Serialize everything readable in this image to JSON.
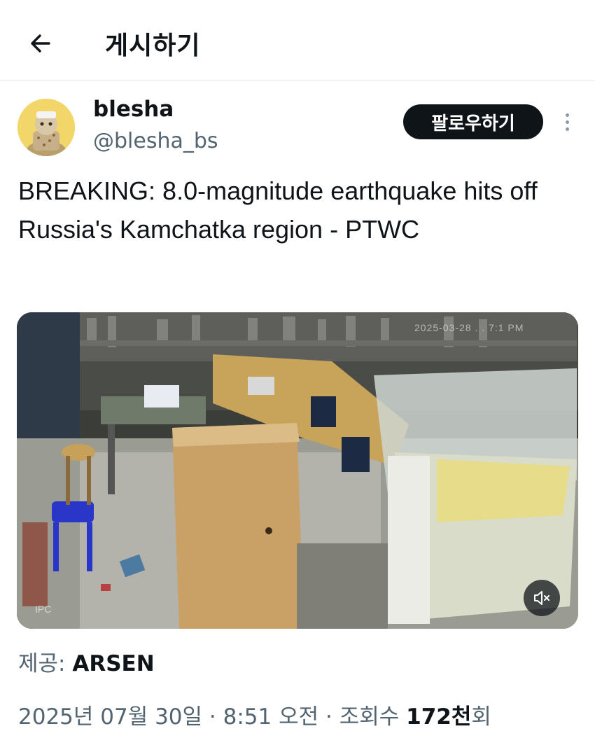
{
  "header": {
    "title": "게시하기",
    "back_icon": "arrow-left-icon"
  },
  "author": {
    "display_name": "blesha",
    "handle": "@blesha_bs",
    "follow_label": "팔로우하기",
    "more_icon": "more-vertical-icon"
  },
  "tweet": {
    "text": "BREAKING: 8.0-magnitude earthquake hits off Russia's Kamchatka region - PTWC"
  },
  "media": {
    "timestamp_overlay": "2025-03-28 . . 7:1 PM",
    "camera_label": "IPC",
    "mute_icon": "speaker-muted-icon"
  },
  "source": {
    "prefix": "제공: ",
    "name": "ARSEN"
  },
  "meta": {
    "date": "2025년 07월 30일",
    "sep1": " · ",
    "time": "8:51 오전",
    "sep2": " · ",
    "views_label": "조회수 ",
    "views_count": "172천",
    "views_suffix": "회"
  },
  "colors": {
    "primary_text": "#0f1419",
    "secondary_text": "#536471",
    "follow_bg": "#0f1419",
    "avatar_bg": "#f3d66a"
  }
}
